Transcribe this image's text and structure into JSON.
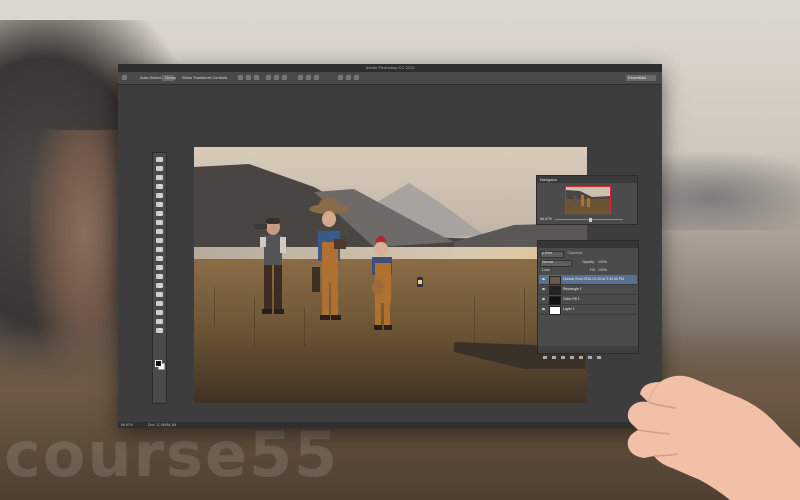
{
  "window": {
    "title": "Adobe Photoshop CC 2015",
    "workspace_label": "Essentials",
    "options": {
      "auto_select": "Auto-Select:",
      "auto_select_target": "Group",
      "transform_controls": "Show Transform Controls"
    },
    "status": {
      "zoom": "66.67%",
      "doc_size": "Doc: 11.5M/54.1M"
    }
  },
  "tools": [
    "move-tool",
    "marquee-tool",
    "lasso-tool",
    "quick-selection-tool",
    "crop-tool",
    "eyedropper-tool",
    "healing-brush-tool",
    "brush-tool",
    "clone-stamp-tool",
    "history-brush-tool",
    "eraser-tool",
    "gradient-tool",
    "blur-tool",
    "dodge-tool",
    "pen-tool",
    "type-tool",
    "path-selection-tool",
    "rectangle-tool",
    "hand-tool",
    "zoom-tool"
  ],
  "navigator": {
    "title": "Navigator",
    "zoom": "66.67%"
  },
  "layers_panel": {
    "tabs": [
      "Paths",
      "Layers",
      "Channels"
    ],
    "active_tab": "Layers",
    "filter_label": "p Kind",
    "blend_mode": "Normal",
    "opacity_label": "Opacity:",
    "opacity": "100%",
    "lock_label": "Lock:",
    "fill_label": "Fill:",
    "fill": "100%",
    "layers": [
      {
        "name": "Classic Shot 2016-01-26 at 2.34.53 PM",
        "selected": true,
        "thumb": "#6b5a48"
      },
      {
        "name": "Rectangle 1",
        "selected": false,
        "thumb": "#222222"
      },
      {
        "name": "Color Fill 1",
        "selected": false,
        "thumb": "#111111"
      },
      {
        "name": "Layer 1",
        "selected": false,
        "thumb": "#ffffff"
      }
    ]
  },
  "watermark": "course55",
  "colors": {
    "selection": "#5d6f8f",
    "panel": "#4b4b4b",
    "workspace": "#3d3d3d"
  }
}
